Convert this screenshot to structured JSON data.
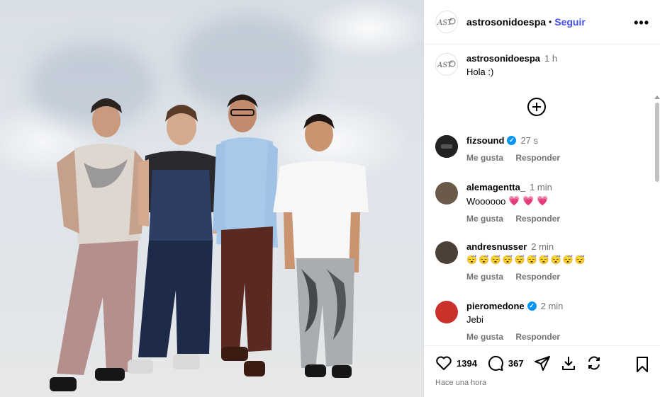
{
  "post": {
    "username": "astrosonidoespa",
    "follow_label": "Seguir",
    "more_label": "•••",
    "avatar_logo": "ASTR"
  },
  "caption": {
    "username": "astrosonidoespa",
    "time": "1 h",
    "text": "Hola :)"
  },
  "load_more_label": "⊕",
  "comments": [
    {
      "username": "fizsound",
      "verified": true,
      "time": "27 s",
      "text": "",
      "like_label": "Me gusta",
      "reply_label": "Responder",
      "avatar_color": "#1a1a1a"
    },
    {
      "username": "alemagentta_",
      "verified": false,
      "time": "1 min",
      "text": "Woooooo",
      "hearts": "💗 💗 💗",
      "like_label": "Me gusta",
      "reply_label": "Responder",
      "avatar_color": "#6b5a4a"
    },
    {
      "username": "andresnusser",
      "verified": false,
      "time": "2 min",
      "text": "",
      "emojis": "😴😴😴😴😴😴😴😴😴😴",
      "like_label": "Me gusta",
      "reply_label": "Responder",
      "avatar_color": "#4a4036"
    },
    {
      "username": "pieromedone",
      "verified": true,
      "time": "2 min",
      "text": "Jebi",
      "like_label": "Me gusta",
      "reply_label": "Responder",
      "avatar_color": "#c8322a"
    }
  ],
  "stats": {
    "likes": "1394",
    "comments": "367"
  },
  "posted_time": "Hace una hora",
  "colors": {
    "accent": "#4150f7",
    "verified": "#0095f6",
    "muted": "#737373"
  }
}
